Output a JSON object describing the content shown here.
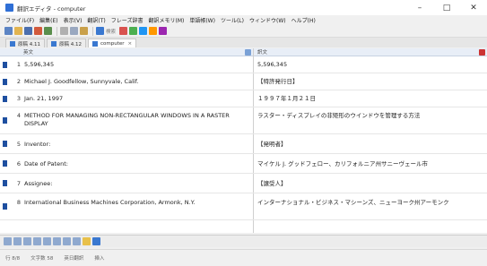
{
  "window": {
    "title": "翻訳エディタ - computer",
    "controls": [
      "–",
      "□",
      "✕"
    ]
  },
  "menu": [
    "ファイル(F)",
    "編集(E)",
    "表示(V)",
    "翻訳(T)",
    "フレーズ辞書",
    "翻訳メモリ(M)",
    "単語帳(W)",
    "ツール(L)",
    "ウィンドウ(W)",
    "ヘルプ(H)"
  ],
  "toolbar": {
    "text_label": "検索",
    "buttons": [
      "new-icon",
      "open-icon",
      "save-icon",
      "undo-icon",
      "redo-icon",
      "cut-icon",
      "copy-icon",
      "paste-icon",
      "translate-icon",
      "search-icon"
    ]
  },
  "tabs": [
    {
      "label": "原稿 4.11"
    },
    {
      "label": "原稿 4.12"
    },
    {
      "label": "computer"
    }
  ],
  "grid": {
    "source_header": "英文",
    "target_header": "訳文",
    "rows": [
      {
        "num": "1",
        "source": "5,596,345",
        "target": "5,596,345"
      },
      {
        "num": "2",
        "source": "Michael J. Goodfellow, Sunnyvale, Calif.",
        "target": "【特許発行日】"
      },
      {
        "num": "3",
        "source": "Jan. 21, 1997",
        "target": "１９９７年１月２１日"
      },
      {
        "num": "4",
        "source": "METHOD FOR MANAGING NON-RECTANGULAR WINDOWS IN A RASTER DISPLAY",
        "target": "ラスター・ディスプレイの非矩形のウインドウを管理する方法"
      },
      {
        "num": "5",
        "source": "Inventor:",
        "target": "【発明者】"
      },
      {
        "num": "6",
        "source": "Date of Patent:",
        "target": "マイケル J. グッドフェロー、カリフォルニア州サニーヴェール市"
      },
      {
        "num": "7",
        "source": "Assignee:",
        "target": "【譲受人】"
      },
      {
        "num": "8",
        "source": "International Business Machines Corporation, Armonk, N.Y.",
        "target": "インターナショナル・ビジネス・マシーンズ、ニューヨーク州アーモンク"
      }
    ]
  },
  "status": [
    "行 8/8",
    "文字数 58",
    "英日翻訳",
    "挿入"
  ]
}
